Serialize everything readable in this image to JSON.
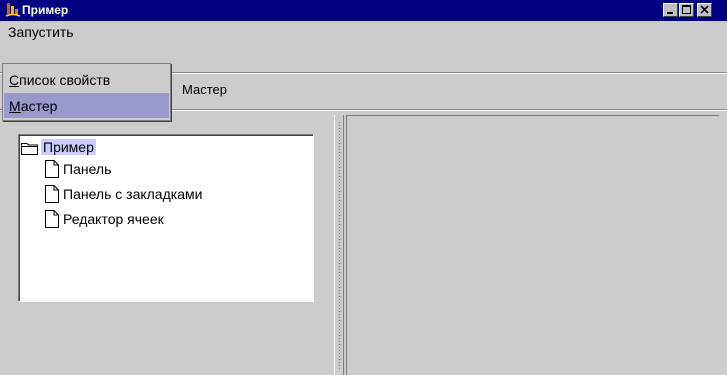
{
  "window": {
    "title": "Пример",
    "controls": [
      "minimize-icon",
      "maximize-icon",
      "close-icon"
    ]
  },
  "menubar": {
    "run_label": "Запустить"
  },
  "popup_menu": {
    "items": [
      {
        "mnemonic": "С",
        "rest": "писок свойств",
        "selected": false
      },
      {
        "mnemonic": "М",
        "rest": "астер",
        "selected": true
      }
    ]
  },
  "tab": {
    "label": "Мастер"
  },
  "tree": {
    "root": {
      "label": "Пример",
      "icon": "folder-icon"
    },
    "children": [
      {
        "label": "Панель",
        "icon": "document-icon"
      },
      {
        "label": "Панель с закладками",
        "icon": "document-icon"
      },
      {
        "label": "Редактор ячеек",
        "icon": "document-icon"
      }
    ]
  },
  "colors": {
    "titlebar": "#000080",
    "selection": "#9999cc",
    "background": "#cccccc"
  }
}
